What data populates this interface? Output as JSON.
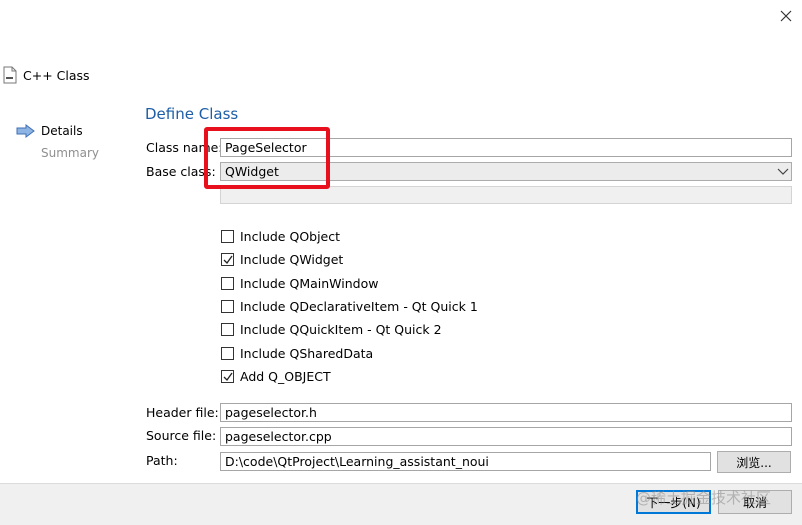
{
  "window": {
    "close_icon": "close-icon"
  },
  "header": {
    "title": "C++ Class"
  },
  "steps": [
    {
      "label": "Details",
      "active": true
    },
    {
      "label": "Summary",
      "active": false
    }
  ],
  "main": {
    "section_title": "Define Class",
    "class_name": {
      "label": "Class name:",
      "value": "PageSelector"
    },
    "base_class": {
      "label": "Base class:",
      "value": "QWidget"
    },
    "checkboxes": [
      {
        "label": "Include QObject",
        "checked": false
      },
      {
        "label": "Include QWidget",
        "checked": true
      },
      {
        "label": "Include QMainWindow",
        "checked": false
      },
      {
        "label": "Include QDeclarativeItem - Qt Quick 1",
        "checked": false
      },
      {
        "label": "Include QQuickItem - Qt Quick 2",
        "checked": false
      },
      {
        "label": "Include QSharedData",
        "checked": false
      },
      {
        "label": "Add Q_OBJECT",
        "checked": true
      }
    ],
    "header_file": {
      "label": "Header file:",
      "value": "pageselector.h"
    },
    "source_file": {
      "label": "Source file:",
      "value": "pageselector.cpp"
    },
    "path": {
      "label": "Path:",
      "value": "D:\\code\\QtProject\\Learning_assistant_noui"
    },
    "browse_label": "浏览..."
  },
  "footer": {
    "next_label": "下一步(N)",
    "cancel_label": "取消"
  },
  "watermark": "@稀土掘金技术社区",
  "colors": {
    "accent": "#1d5ea7",
    "highlight": "#e8101c",
    "focus": "#0078d7"
  }
}
